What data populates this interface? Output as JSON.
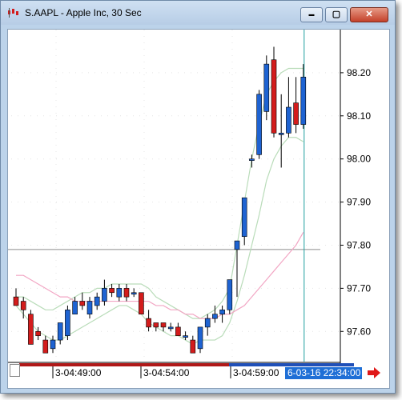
{
  "window": {
    "title": "S.AAPL - Apple Inc, 30 Sec",
    "buttons": {
      "minimize": "▬",
      "restore": "▢",
      "close": "✕"
    }
  },
  "colors": {
    "up_candle": "#1e63d2",
    "down_candle": "#d31c1c",
    "band": "#b9dcb9",
    "moving_average": "#f2a6c4",
    "horizontal_line": "#8c8c8c",
    "cursor_line": "#1fa0a0",
    "date_highlight": "#1f6fd6"
  },
  "chart_data": {
    "type": "candlestick",
    "title": "S.AAPL - Apple Inc, 30 Sec",
    "y_ticks": [
      "98.20",
      "98.10",
      "98.00",
      "97.90",
      "97.80",
      "97.70",
      "97.60"
    ],
    "ylim": [
      97.53,
      98.3
    ],
    "x_ticks": [
      "3-04:49:00",
      "3-04:54:00",
      "3-04:59:00"
    ],
    "cursor_date": "6-03-16 22:34:00",
    "horizontal_line_value": 97.79,
    "candles": [
      {
        "o": 97.68,
        "h": 97.7,
        "l": 97.66,
        "c": 97.66
      },
      {
        "o": 97.67,
        "h": 97.68,
        "l": 97.63,
        "c": 97.65
      },
      {
        "o": 97.64,
        "h": 97.65,
        "l": 97.57,
        "c": 97.57
      },
      {
        "o": 97.6,
        "h": 97.61,
        "l": 97.58,
        "c": 97.59
      },
      {
        "o": 97.58,
        "h": 97.59,
        "l": 97.55,
        "c": 97.55
      },
      {
        "o": 97.56,
        "h": 97.59,
        "l": 97.55,
        "c": 97.58
      },
      {
        "o": 97.58,
        "h": 97.62,
        "l": 97.57,
        "c": 97.62
      },
      {
        "o": 97.59,
        "h": 97.66,
        "l": 97.58,
        "c": 97.65
      },
      {
        "o": 97.64,
        "h": 97.68,
        "l": 97.64,
        "c": 97.67
      },
      {
        "o": 97.67,
        "h": 97.69,
        "l": 97.65,
        "c": 97.66
      },
      {
        "o": 97.64,
        "h": 97.68,
        "l": 97.63,
        "c": 97.67
      },
      {
        "o": 97.66,
        "h": 97.69,
        "l": 97.65,
        "c": 97.68
      },
      {
        "o": 97.67,
        "h": 97.72,
        "l": 97.66,
        "c": 97.7
      },
      {
        "o": 97.7,
        "h": 97.71,
        "l": 97.68,
        "c": 97.69
      },
      {
        "o": 97.68,
        "h": 97.71,
        "l": 97.67,
        "c": 97.7
      },
      {
        "o": 97.7,
        "h": 97.71,
        "l": 97.67,
        "c": 97.68
      },
      {
        "o": 97.69,
        "h": 97.7,
        "l": 97.68,
        "c": 97.69
      },
      {
        "o": 97.69,
        "h": 97.69,
        "l": 97.64,
        "c": 97.64
      },
      {
        "o": 97.63,
        "h": 97.65,
        "l": 97.6,
        "c": 97.61
      },
      {
        "o": 97.62,
        "h": 97.62,
        "l": 97.6,
        "c": 97.61
      },
      {
        "o": 97.62,
        "h": 97.62,
        "l": 97.6,
        "c": 97.61
      },
      {
        "o": 97.61,
        "h": 97.62,
        "l": 97.6,
        "c": 97.61
      },
      {
        "o": 97.61,
        "h": 97.62,
        "l": 97.59,
        "c": 97.59
      },
      {
        "o": 97.59,
        "h": 97.6,
        "l": 97.58,
        "c": 97.59
      },
      {
        "o": 97.58,
        "h": 97.59,
        "l": 97.55,
        "c": 97.55
      },
      {
        "o": 97.56,
        "h": 97.61,
        "l": 97.55,
        "c": 97.61
      },
      {
        "o": 97.61,
        "h": 97.64,
        "l": 97.59,
        "c": 97.63
      },
      {
        "o": 97.63,
        "h": 97.66,
        "l": 97.62,
        "c": 97.64
      },
      {
        "o": 97.64,
        "h": 97.66,
        "l": 97.62,
        "c": 97.65
      },
      {
        "o": 97.65,
        "h": 97.72,
        "l": 97.64,
        "c": 97.72
      },
      {
        "o": 97.79,
        "h": 97.81,
        "l": 97.68,
        "c": 97.81
      },
      {
        "o": 97.82,
        "h": 97.91,
        "l": 97.8,
        "c": 97.91
      },
      {
        "o": 98.0,
        "h": 98.01,
        "l": 97.98,
        "c": 98.0
      },
      {
        "o": 98.01,
        "h": 98.16,
        "l": 98.0,
        "c": 98.15
      },
      {
        "o": 98.11,
        "h": 98.24,
        "l": 98.09,
        "c": 98.22
      },
      {
        "o": 98.23,
        "h": 98.26,
        "l": 98.05,
        "c": 98.06
      },
      {
        "o": 98.06,
        "h": 98.15,
        "l": 97.98,
        "c": 98.06
      },
      {
        "o": 98.06,
        "h": 98.19,
        "l": 98.05,
        "c": 98.12
      },
      {
        "o": 98.13,
        "h": 98.19,
        "l": 98.06,
        "c": 98.08
      },
      {
        "o": 98.08,
        "h": 98.22,
        "l": 98.07,
        "c": 98.19
      }
    ],
    "upper_band": [
      97.68,
      97.68,
      97.67,
      97.66,
      97.65,
      97.65,
      97.66,
      97.67,
      97.68,
      97.69,
      97.69,
      97.7,
      97.7,
      97.71,
      97.71,
      97.71,
      97.71,
      97.71,
      97.7,
      97.68,
      97.67,
      97.66,
      97.65,
      97.64,
      97.63,
      97.63,
      97.64,
      97.65,
      97.67,
      97.7,
      97.8,
      97.9,
      98.0,
      98.08,
      98.15,
      98.18,
      98.2,
      98.21,
      98.21,
      98.21
    ],
    "lower_band": [
      97.66,
      97.64,
      97.62,
      97.6,
      97.59,
      97.58,
      97.58,
      97.59,
      97.6,
      97.61,
      97.62,
      97.63,
      97.64,
      97.65,
      97.66,
      97.66,
      97.65,
      97.64,
      97.62,
      97.61,
      97.6,
      97.59,
      97.59,
      97.58,
      97.57,
      97.58,
      97.58,
      97.58,
      97.59,
      97.62,
      97.67,
      97.73,
      97.8,
      97.87,
      97.95,
      98.0,
      98.03,
      98.05,
      98.05,
      98.04
    ],
    "moving_average": [
      97.73,
      97.73,
      97.72,
      97.71,
      97.7,
      97.69,
      97.68,
      97.68,
      97.67,
      97.67,
      97.67,
      97.67,
      97.67,
      97.67,
      97.67,
      97.67,
      97.67,
      97.67,
      97.67,
      97.66,
      97.66,
      97.65,
      97.65,
      97.64,
      97.64,
      97.63,
      97.63,
      97.63,
      97.64,
      97.64,
      97.65,
      97.66,
      97.68,
      97.7,
      97.72,
      97.74,
      97.76,
      97.78,
      97.8,
      97.83
    ]
  }
}
